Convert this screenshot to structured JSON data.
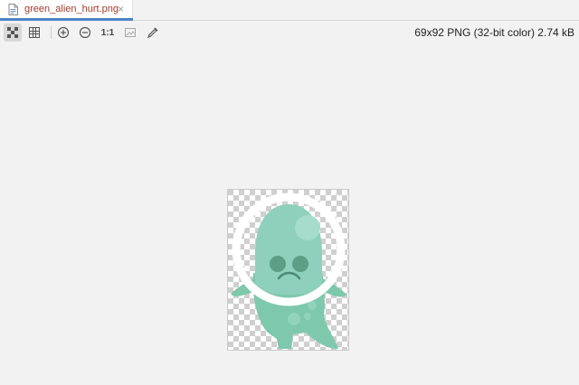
{
  "tab": {
    "filename": "green_alien_hurt.png",
    "close_glyph": "×",
    "icon": "image-file-icon"
  },
  "toolbar": {
    "buttons": [
      {
        "name": "chessboard-toggle",
        "icon": "chessboard-icon",
        "active": true
      },
      {
        "name": "grid-toggle",
        "icon": "grid-icon",
        "active": false
      },
      {
        "name": "zoom-in",
        "icon": "zoom-in-icon"
      },
      {
        "name": "zoom-out",
        "icon": "zoom-out-icon"
      },
      {
        "name": "actual-size",
        "label": "1:1"
      },
      {
        "name": "fit-zoom",
        "icon": "fit-image-icon"
      },
      {
        "name": "color-picker",
        "icon": "eyedropper-icon"
      }
    ],
    "actual_size_label": "1:1"
  },
  "image_info": "69x92 PNG (32-bit color) 2.74 kB",
  "image": {
    "description_colors": {
      "body": "#7ec8ad",
      "head": "#8ed0bb",
      "helmet": "#ffffff",
      "eyes": "#5c9e86",
      "checker_dark": "#c8c8c8",
      "checker_light": "#ffffff"
    }
  }
}
